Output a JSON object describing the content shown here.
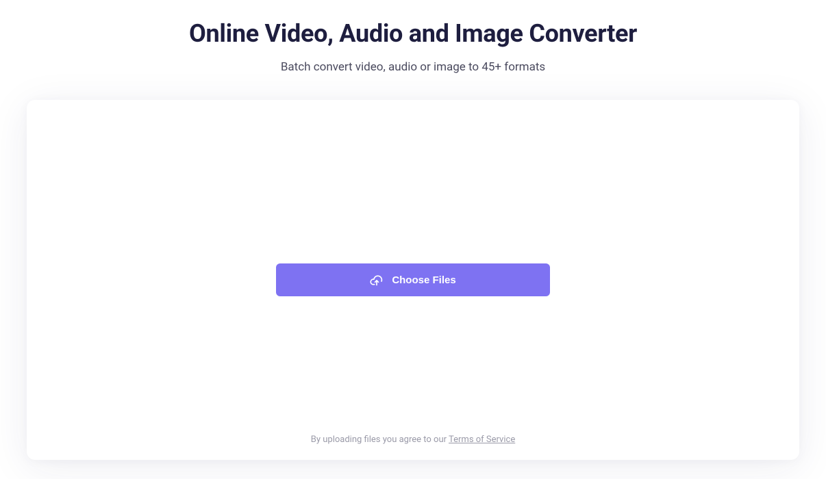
{
  "header": {
    "title": "Online Video, Audio and Image Converter",
    "subtitle": "Batch convert video, audio or image to 45+ formats"
  },
  "upload": {
    "button_label": "Choose Files"
  },
  "footer": {
    "agreement_prefix": "By uploading files you agree to our ",
    "terms_link_text": "Terms of Service"
  }
}
